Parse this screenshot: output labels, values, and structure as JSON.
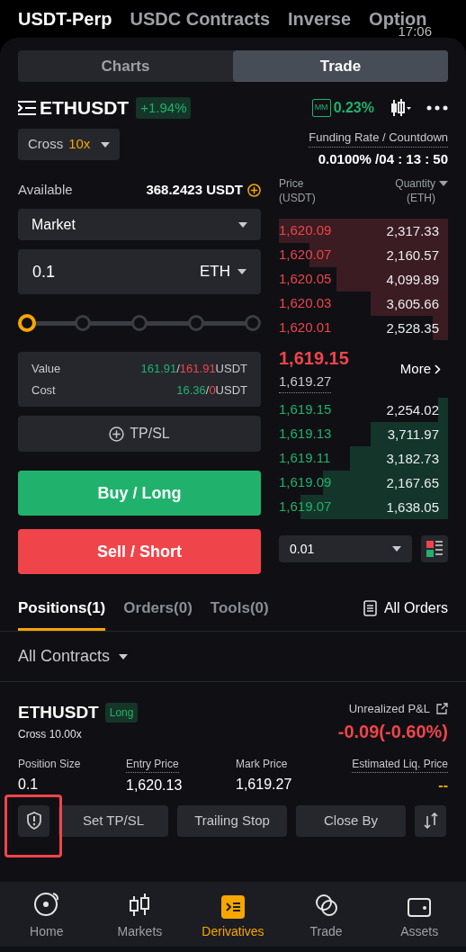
{
  "market_tabs": [
    {
      "label": "USDT-Perp",
      "selected": true
    },
    {
      "label": "USDC Contracts",
      "selected": false
    },
    {
      "label": "Inverse",
      "selected": false
    },
    {
      "label": "Option",
      "selected": false
    }
  ],
  "clock": "17:06",
  "view_tabs": [
    {
      "label": "Charts",
      "selected": false
    },
    {
      "label": "Trade",
      "selected": true
    }
  ],
  "symbol": {
    "name": "ETHUSDT",
    "change": "+1.94%",
    "mm_label": "MM",
    "mm_rate": "0.23%"
  },
  "margin": {
    "mode": "Cross",
    "leverage": "10x"
  },
  "funding": {
    "label": "Funding Rate / Countdown",
    "value": "0.0100% /04 : 13 : 50"
  },
  "available": {
    "label": "Available",
    "value": "368.2423 USDT"
  },
  "order_type": "Market",
  "quantity": {
    "value": "0.1",
    "unit": "ETH"
  },
  "slider": {
    "level": 0
  },
  "summary": [
    {
      "label": "Value",
      "buy": "161.91",
      "sep": "/",
      "sell": "161.91",
      "unit": "USDT"
    },
    {
      "label": "Cost",
      "buy": "16.36",
      "sep": "/",
      "sell": "0",
      "unit": "USDT"
    }
  ],
  "tpsl_button": "TP/SL",
  "buy_button": "Buy / Long",
  "sell_button": "Sell / Short",
  "order_book": {
    "price_header": "Price\n(USDT)",
    "qty_header": "Quantity\n(ETH)",
    "asks": [
      {
        "price": "1,620.09",
        "qty": "2,317.33"
      },
      {
        "price": "1,620.07",
        "qty": "2,160.57"
      },
      {
        "price": "1,620.05",
        "qty": "4,099.89"
      },
      {
        "price": "1,620.03",
        "qty": "3,605.66"
      },
      {
        "price": "1,620.01",
        "qty": "2,528.35"
      }
    ],
    "last_price": "1,619.15",
    "mark_price": "1,619.27",
    "more": "More",
    "bids": [
      {
        "price": "1,619.15",
        "qty": "2,254.02"
      },
      {
        "price": "1,619.13",
        "qty": "3,711.97"
      },
      {
        "price": "1,619.11",
        "qty": "3,182.73"
      },
      {
        "price": "1,619.09",
        "qty": "2,167.65"
      },
      {
        "price": "1,619.07",
        "qty": "1,638.05"
      }
    ],
    "precision": "0.01"
  },
  "bottom_tabs": [
    {
      "label": "Positions(1)",
      "selected": true
    },
    {
      "label": "Orders(0)",
      "selected": false
    },
    {
      "label": "Tools(0)",
      "selected": false
    }
  ],
  "all_orders": "All Orders",
  "contracts_filter": "All Contracts",
  "position": {
    "symbol": "ETHUSDT",
    "side": "Long",
    "margin": "Cross 10.00x",
    "pnl_label": "Unrealized P&L",
    "pnl": "-0.09(-0.60%)",
    "fields": [
      {
        "label": "Position Size",
        "value": "0.1"
      },
      {
        "label": "Entry Price",
        "value": "1,620.13"
      },
      {
        "label": "Mark Price",
        "value": "1,619.27"
      },
      {
        "label": "Estimated Liq. Price",
        "value": "--"
      }
    ],
    "actions": [
      "Set TP/SL",
      "Trailing Stop",
      "Close By"
    ]
  },
  "nav": [
    {
      "label": "Home",
      "selected": false
    },
    {
      "label": "Markets",
      "selected": false
    },
    {
      "label": "Derivatives",
      "selected": true
    },
    {
      "label": "Trade",
      "selected": false
    },
    {
      "label": "Assets",
      "selected": false
    }
  ]
}
